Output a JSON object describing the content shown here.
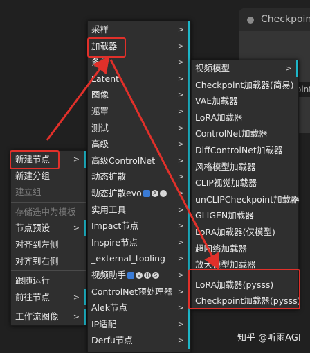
{
  "background_node": {
    "title": "Checkpoint",
    "field_fragment": "oint"
  },
  "left_menu": {
    "items": [
      {
        "label": "新建节点",
        "submenu": true,
        "highlighted": true
      },
      {
        "label": "新建分组"
      },
      {
        "label": "建立组",
        "disabled": true
      },
      {
        "separator": true
      },
      {
        "label": "存储选中为模板",
        "disabled": true
      },
      {
        "label": "节点预设",
        "submenu": true
      },
      {
        "label": "对齐到左侧"
      },
      {
        "label": "对齐到右侧"
      },
      {
        "separator": true
      },
      {
        "label": "跟随运行"
      },
      {
        "label": "前往节点",
        "submenu": true
      },
      {
        "separator": true
      },
      {
        "label": "工作流图像",
        "submenu": true
      }
    ]
  },
  "mid_menu": {
    "items": [
      {
        "label": "采样",
        "submenu": true
      },
      {
        "label": "加载器",
        "submenu": true,
        "highlighted": true
      },
      {
        "label": "条件",
        "submenu": true
      },
      {
        "label": "Latent",
        "submenu": true
      },
      {
        "label": "图像",
        "submenu": true
      },
      {
        "label": "遮罩",
        "submenu": true
      },
      {
        "label": "测试",
        "submenu": true
      },
      {
        "label": "高级",
        "submenu": true
      },
      {
        "label": "高级ControlNet",
        "submenu": true
      },
      {
        "label": "动态扩散",
        "submenu": true
      },
      {
        "label": "动态扩散evo",
        "submenu": true,
        "icons": [
          "emoji",
          "A",
          "ⓘ"
        ]
      },
      {
        "label": "实用工具",
        "submenu": true
      },
      {
        "label": "Impact节点",
        "submenu": true
      },
      {
        "label": "Inspire节点",
        "submenu": true
      },
      {
        "label": "_external_tooling",
        "submenu": true
      },
      {
        "label": "视频助手",
        "submenu": true,
        "icons": [
          "camera",
          "V",
          "H",
          "S"
        ]
      },
      {
        "label": "ControlNet预处理器",
        "submenu": true
      },
      {
        "label": "Alek节点",
        "submenu": true
      },
      {
        "label": "IP适配",
        "submenu": true
      },
      {
        "label": "Derfu节点",
        "submenu": true
      }
    ]
  },
  "right_menu": {
    "items": [
      {
        "label": "视频模型",
        "submenu": true
      },
      {
        "label": "Checkpoint加载器(简易)"
      },
      {
        "label": "VAE加载器"
      },
      {
        "label": "LoRA加载器"
      },
      {
        "label": "ControlNet加载器"
      },
      {
        "label": "DiffControlNet加载器"
      },
      {
        "label": "风格模型加载器"
      },
      {
        "label": "CLIP视觉加载器"
      },
      {
        "label": "unCLIPCheckpoint加载器"
      },
      {
        "label": "GLIGEN加载器"
      },
      {
        "label": "LoRA加载器(仅模型)"
      },
      {
        "label": "超网络加载器"
      },
      {
        "label": "放大模型加载器"
      },
      {
        "label": "LoRA加载器(pysss)",
        "highlighted": true
      },
      {
        "label": "Checkpoint加载器(pysss)",
        "highlighted": true
      }
    ]
  },
  "watermark": "知乎 @听雨AGI",
  "colors": {
    "menu_bg": "#2f2f2f",
    "submenu_marker": "#1db6c8",
    "highlight_box": "#e1302a",
    "arrow": "#e1302a"
  }
}
